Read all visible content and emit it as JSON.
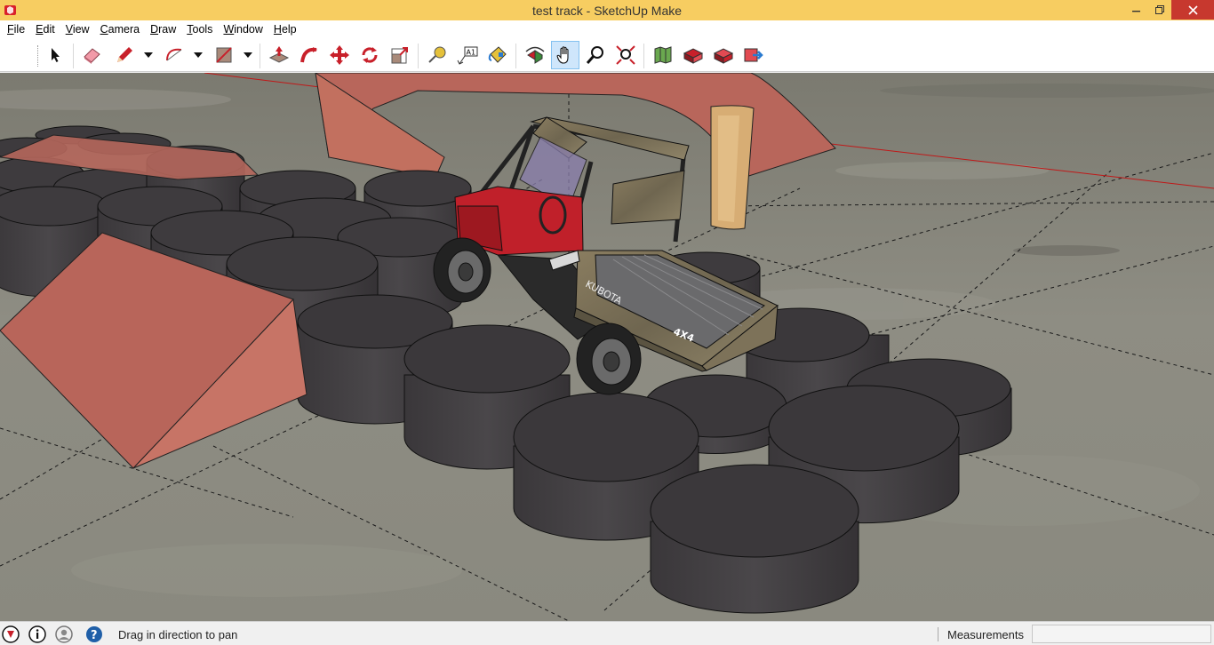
{
  "window": {
    "title": "test track - SketchUp Make",
    "controls": [
      "minimize",
      "maximize",
      "close"
    ]
  },
  "menu": [
    {
      "label": "File",
      "underline": "F",
      "rest": "ile"
    },
    {
      "label": "Edit",
      "underline": "E",
      "rest": "dit"
    },
    {
      "label": "View",
      "underline": "V",
      "rest": "iew"
    },
    {
      "label": "Camera",
      "underline": "C",
      "rest": "amera"
    },
    {
      "label": "Draw",
      "underline": "D",
      "rest": "raw"
    },
    {
      "label": "Tools",
      "underline": "T",
      "rest": "ools"
    },
    {
      "label": "Window",
      "underline": "W",
      "rest": "indow"
    },
    {
      "label": "Help",
      "underline": "H",
      "rest": "elp"
    }
  ],
  "toolbar": {
    "tools": [
      "select",
      "eraser",
      "line",
      "arc",
      "rectangle",
      "push-pull",
      "follow-me",
      "move",
      "rotate",
      "scale",
      "tape-measure",
      "text",
      "paint-bucket",
      "orbit",
      "pan",
      "zoom",
      "zoom-extents",
      "add-location",
      "3d-warehouse",
      "share-model",
      "extension-warehouse"
    ],
    "active_tool": "pan"
  },
  "statusbar": {
    "hint": "Drag in direction to pan",
    "measurements_label": "Measurements",
    "measurements_value": ""
  },
  "model": {
    "vehicle_labels": [
      "KUBOTA",
      "4X4"
    ]
  },
  "colors": {
    "title_bar": "#f7cd61",
    "close_button": "#c7382e",
    "active_tool_bg": "#cfe6fb",
    "ramp_red": "#b8655a",
    "tire_dark": "#3e3b3e",
    "ground": "#8b8a80",
    "utv_red": "#c0202a"
  }
}
